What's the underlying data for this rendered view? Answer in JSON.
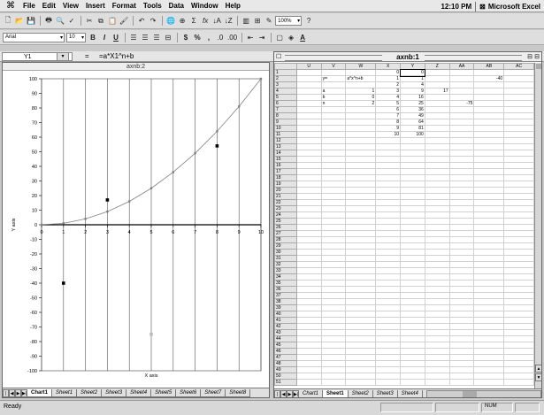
{
  "menubar": {
    "apple": "",
    "items": [
      "File",
      "Edit",
      "View",
      "Insert",
      "Format",
      "Tools",
      "Data",
      "Window",
      "Help"
    ],
    "clock": "12:10 PM",
    "app_name": "Microsoft Excel"
  },
  "toolbar": {
    "zoom": "100%",
    "font_name": "Arial",
    "font_size": "10",
    "bold": "B",
    "italic": "I",
    "underline": "U",
    "currency": "$",
    "percent": "%",
    "comma": ",",
    "sum": "Σ",
    "fx": "fx"
  },
  "formula_bar": {
    "name_box": "Y1",
    "equals": "=",
    "formula": "=a*X1^n+b"
  },
  "chart_window": {
    "title": "axnb:2"
  },
  "chart_data": {
    "type": "scatter",
    "title": "",
    "xlabel": "X axis",
    "ylabel": "Y axis",
    "xlim": [
      0,
      10
    ],
    "ylim": [
      -100,
      100
    ],
    "x_ticks": [
      0,
      1,
      2,
      3,
      4,
      5,
      6,
      7,
      8,
      9,
      10
    ],
    "y_ticks": [
      -100,
      -90,
      -80,
      -70,
      -60,
      -50,
      -40,
      -30,
      -20,
      -10,
      0,
      10,
      20,
      30,
      40,
      50,
      60,
      70,
      80,
      90,
      100
    ],
    "series": [
      {
        "x": [
          0,
          1,
          2,
          3,
          4,
          5,
          6,
          7,
          8,
          9,
          10
        ],
        "y": [
          0,
          1,
          4,
          9,
          16,
          25,
          36,
          49,
          64,
          81,
          100
        ],
        "line": true,
        "color": "#808080"
      },
      {
        "x": [
          1,
          3,
          8,
          5
        ],
        "y": [
          -40,
          17,
          54,
          -75
        ],
        "line": false,
        "color": "#000000"
      }
    ]
  },
  "chart_tabs": {
    "tabs": [
      "Chart1",
      "Sheet1",
      "Sheet2",
      "Sheet3",
      "Sheet4",
      "Sheet5",
      "Sheet6",
      "Sheet7",
      "Sheet8"
    ],
    "active": "Chart1"
  },
  "sheet_window": {
    "title": "axnb:1",
    "columns": [
      "U",
      "V",
      "W",
      "X",
      "Y",
      "Z",
      "AA",
      "AB",
      "AC"
    ],
    "rows": [
      [
        "",
        "",
        "",
        "0",
        "0",
        "",
        "",
        "",
        ""
      ],
      [
        "",
        "y=",
        "a*x^n+b",
        "1",
        "1",
        "",
        "",
        "-40",
        ""
      ],
      [
        "",
        "",
        "",
        "2",
        "4",
        "",
        "",
        "",
        ""
      ],
      [
        "",
        "a",
        "1",
        "3",
        "9",
        "17",
        "",
        "",
        ""
      ],
      [
        "",
        "b",
        "0",
        "4",
        "16",
        "",
        "",
        "",
        ""
      ],
      [
        "",
        "n",
        "2",
        "5",
        "25",
        "",
        "-75",
        "",
        ""
      ],
      [
        "",
        "",
        "",
        "6",
        "36",
        "",
        "",
        "",
        ""
      ],
      [
        "",
        "",
        "",
        "7",
        "49",
        "",
        "",
        "",
        ""
      ],
      [
        "",
        "",
        "",
        "8",
        "64",
        "",
        "",
        "",
        ""
      ],
      [
        "",
        "",
        "",
        "9",
        "81",
        "",
        "",
        "",
        ""
      ],
      [
        "",
        "",
        "",
        "10",
        "100",
        "",
        "",
        "",
        ""
      ]
    ],
    "row_count": 51
  },
  "sheet_tabs": {
    "tabs": [
      "Chart1",
      "Sheet1",
      "Sheet2",
      "Sheet3",
      "Sheet4"
    ],
    "active": "Sheet1"
  },
  "status": {
    "text": "Ready",
    "num": "NUM"
  }
}
